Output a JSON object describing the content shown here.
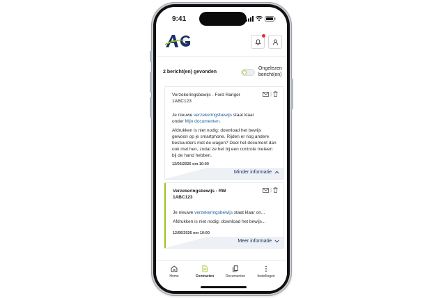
{
  "status_bar": {
    "time": "9:41"
  },
  "header": {
    "logo_text": "AG",
    "colors": {
      "logo_blue": "#1b2f6b",
      "logo_green": "#9ac31c"
    }
  },
  "filter": {
    "found_text": "2 bericht(en) gevonden",
    "toggle_label": "Ongelezen bericht(en)",
    "toggle_on": false
  },
  "messages": [
    {
      "title": "Verzekeringsbewijs - Ford Ranger",
      "reference": "1ABC123",
      "line1_prefix": "Je nieuwe ",
      "line1_link": "verzekeringsbewijs",
      "line1_suffix": " staat klaar",
      "line2_prefix": "onder ",
      "line2_link": "Mijn documenten",
      "line2_suffix": ".",
      "body": "Afdrukken is niet nodig: download het bewijs gewoon op je smartphone. Rijden er nog andere bestuurders met de wagen? Deel het document dan ook met hen, zodat ze het bij een controle meteen bij de hand hebben.",
      "date": "12/06/2026 om 10:00",
      "toggle_label": "Minder informatie",
      "expanded": true,
      "unread": false
    },
    {
      "title": "Verzekeringsbewijs - RW",
      "reference": "1ABC123",
      "line1_prefix": "Je nieuwe ",
      "line1_link": "verzekeringsbewijs",
      "line1_suffix": " staat klaar on...",
      "body": "Afdrukken is niet nodig: download het bewijs...",
      "date": "12/06/2026 om 10:00",
      "toggle_label": "Meer informatie",
      "expanded": false,
      "unread": true
    }
  ],
  "bottom_nav": {
    "items": [
      {
        "label": "Home",
        "icon": "home-icon",
        "active": false
      },
      {
        "label": "Contracten",
        "icon": "document-icon",
        "active": true
      },
      {
        "label": "Documenten",
        "icon": "documents-icon",
        "active": false
      },
      {
        "label": "Instellingen",
        "icon": "more-vertical-icon",
        "active": false
      }
    ]
  },
  "colors": {
    "accent_green": "#9ac31c",
    "link_blue": "#1b5f9e",
    "nav_active": "#9ac31c",
    "notification": "#e2332f"
  }
}
